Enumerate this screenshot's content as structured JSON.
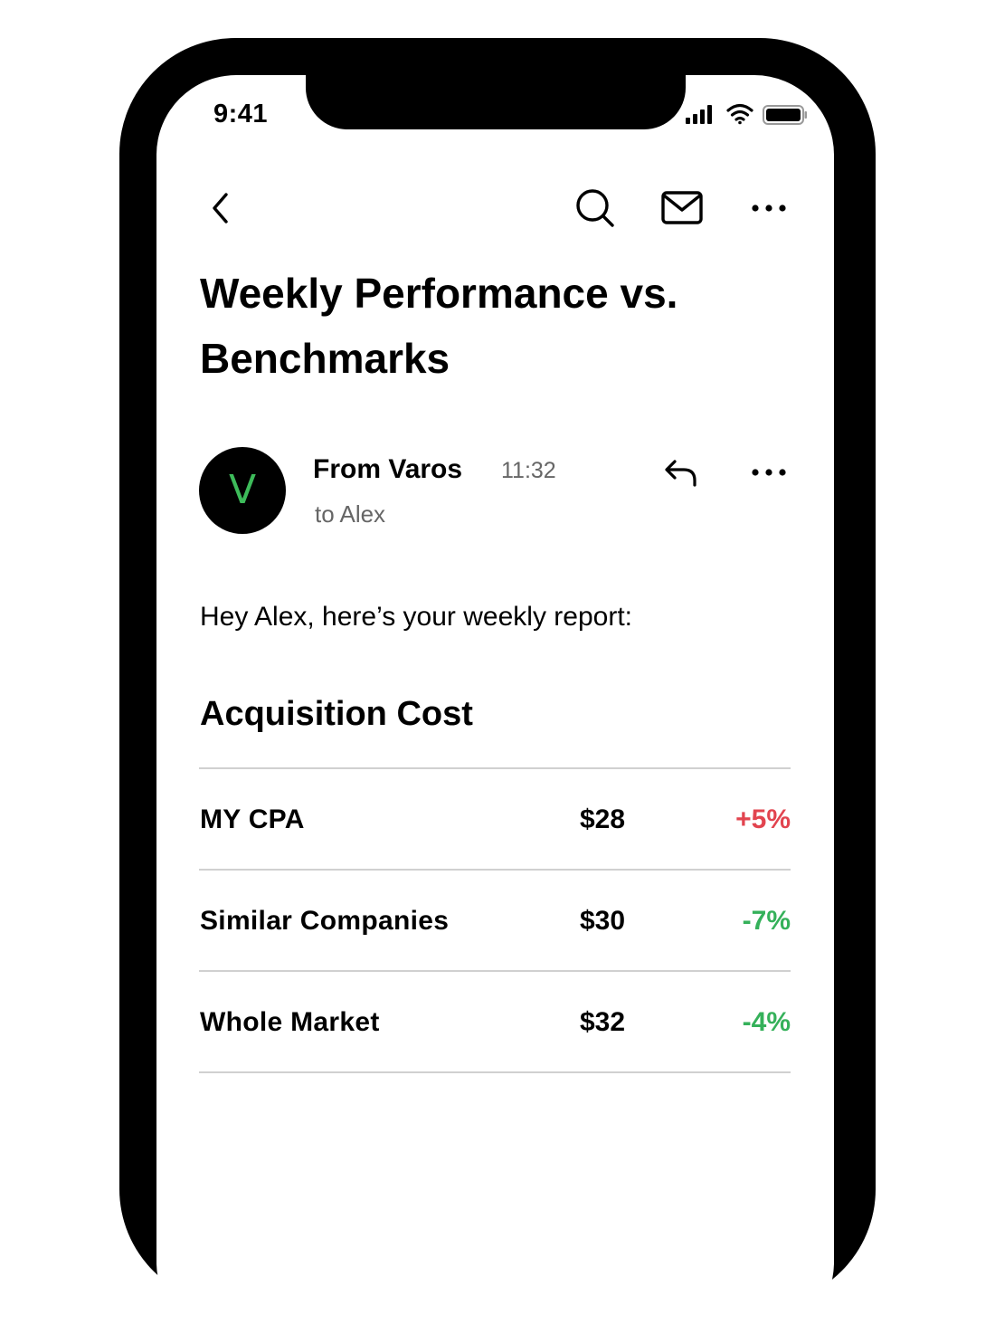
{
  "status_bar": {
    "time": "9:41",
    "icons": [
      "signal-icon",
      "wifi-icon",
      "battery-icon"
    ]
  },
  "nav": {
    "icons": [
      "back-icon",
      "search-icon",
      "mail-icon",
      "more-icon"
    ]
  },
  "email": {
    "subject": "Weekly Performance vs. Benchmarks",
    "sender": {
      "avatar_letter": "V",
      "name": "From Varos",
      "time": "11:32",
      "recipient": "to Alex",
      "icons": [
        "reply-icon",
        "more-icon"
      ]
    },
    "greeting": "Hey Alex, here’s your weekly report:",
    "section_title": "Acquisition Cost",
    "rows": [
      {
        "label": "MY CPA",
        "value": "$28",
        "change": "+5%"
      },
      {
        "label": "Similar Companies",
        "value": "$30",
        "change": "-7%"
      },
      {
        "label": "Whole Market",
        "value": "$32",
        "change": "-4%"
      }
    ]
  },
  "colors": {
    "increase": "#e2444f",
    "decrease": "#35b15a",
    "avatar_letter": "#3dbb5a"
  }
}
